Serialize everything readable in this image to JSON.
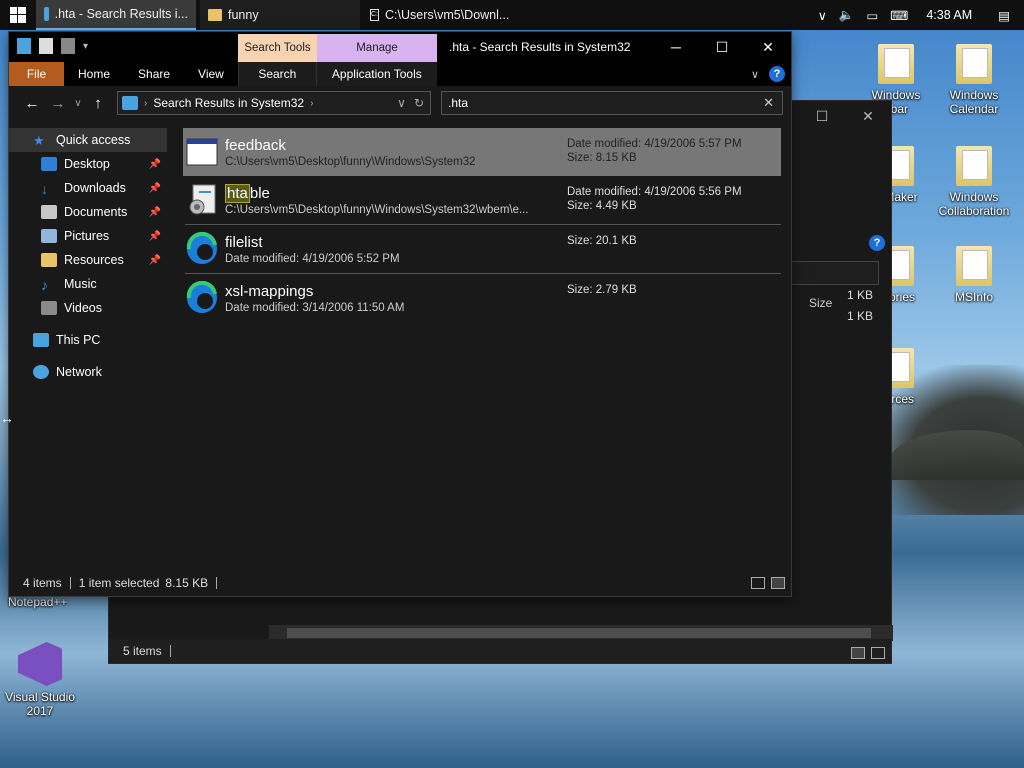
{
  "taskbar": {
    "tasks": [
      {
        "label": ".hta - Search Results i...",
        "icon": "search-folder-icon",
        "active": true
      },
      {
        "label": "funny",
        "icon": "folder-icon"
      },
      {
        "label": "C:\\Users\\vm5\\Downl...",
        "icon": "console-icon"
      }
    ],
    "clock": "4:38 AM"
  },
  "desktop": {
    "icons": [
      {
        "label": "Windows Sidebar",
        "partial": "Windows\nebar"
      },
      {
        "label": "Windows Calendar"
      },
      {
        "label": "Windows Movie Maker",
        "partial": "e Maker"
      },
      {
        "label": "Windows Collaboration"
      },
      {
        "label": "Accessories",
        "partial": "ssories"
      },
      {
        "label": "MSInfo"
      },
      {
        "label": "Resources",
        "partial": "ources"
      },
      {
        "label": "Notepad++"
      },
      {
        "label": "Visual Studio 2017"
      }
    ]
  },
  "back_window": {
    "column_size": "Size",
    "sizes": [
      "1 KB",
      "1 KB"
    ],
    "status": "5 items"
  },
  "window": {
    "title": ".hta - Search Results in System32",
    "context_tabs": {
      "search_tools": "Search Tools",
      "manage": "Manage"
    },
    "ribbon_tabs": [
      "File",
      "Home",
      "Share",
      "View",
      "Search",
      "Application Tools"
    ],
    "address": {
      "path": "Search Results in System32"
    },
    "search": {
      "value": ".hta"
    },
    "nav": [
      {
        "label": "Quick access",
        "icon": "star-icon",
        "color": "#3b8fe0",
        "top": true
      },
      {
        "label": "Desktop",
        "icon": "desktop-icon",
        "color": "#2f7fd4",
        "pinned": true
      },
      {
        "label": "Downloads",
        "icon": "download-icon",
        "color": "#3a89dc",
        "pinned": true
      },
      {
        "label": "Documents",
        "icon": "documents-icon",
        "color": "#c7c7c7",
        "pinned": true
      },
      {
        "label": "Pictures",
        "icon": "pictures-icon",
        "color": "#8fb5d9",
        "pinned": true
      },
      {
        "label": "Resources",
        "icon": "folder-icon",
        "color": "#e8c468",
        "pinned": true
      },
      {
        "label": "Music",
        "icon": "music-icon",
        "color": "#3b8fe0"
      },
      {
        "label": "Videos",
        "icon": "videos-icon",
        "color": "#8a8a8a"
      },
      {
        "label": "This PC",
        "icon": "pc-icon",
        "color": "#4aa3df",
        "top": true
      },
      {
        "label": "Network",
        "icon": "network-icon",
        "color": "#4aa3df",
        "top": true
      }
    ],
    "files": [
      {
        "name": "feedback",
        "sub": "C:\\Users\\vm5\\Desktop\\funny\\Windows\\System32",
        "date": "Date modified: 4/19/2006 5:57 PM",
        "size": "Size: 8.15 KB",
        "icon": "window-file-icon",
        "selected": true
      },
      {
        "name_hl": "hta",
        "name_rest": "ble",
        "sub": "C:\\Users\\vm5\\Desktop\\funny\\Windows\\System32\\wbem\\e...",
        "date": "Date modified: 4/19/2006 5:56 PM",
        "size": "Size: 4.49 KB",
        "icon": "settings-file-icon"
      },
      {
        "name": "filelist",
        "sub": "Date modified: 4/19/2006 5:52 PM",
        "size": "Size: 20.1 KB",
        "icon": "edge-icon"
      },
      {
        "name": "xsl-mappings",
        "sub": "Date modified: 3/14/2006 11:50 AM",
        "size": "Size: 2.79 KB",
        "icon": "edge-icon"
      }
    ],
    "status": {
      "count": "4 items",
      "selected": "1 item selected",
      "size": "8.15 KB"
    }
  }
}
